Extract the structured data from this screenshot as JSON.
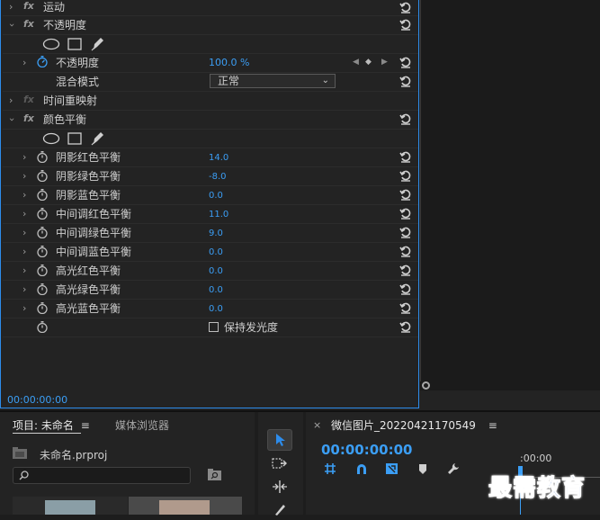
{
  "effects": {
    "motion": {
      "label": "运动"
    },
    "opacity": {
      "label": "不透明度",
      "property_label": "不透明度",
      "property_value": "100.0 %",
      "blend_label": "混合模式",
      "blend_value": "正常"
    },
    "time_remap": {
      "label": "时间重映射"
    },
    "color_balance": {
      "label": "颜色平衡",
      "params": [
        {
          "label": "阴影红色平衡",
          "value": "14.0"
        },
        {
          "label": "阴影绿色平衡",
          "value": "-8.0"
        },
        {
          "label": "阴影蓝色平衡",
          "value": "0.0"
        },
        {
          "label": "中间调红色平衡",
          "value": "11.0"
        },
        {
          "label": "中间调绿色平衡",
          "value": "9.0"
        },
        {
          "label": "中间调蓝色平衡",
          "value": "0.0"
        },
        {
          "label": "高光红色平衡",
          "value": "0.0"
        },
        {
          "label": "高光绿色平衡",
          "value": "0.0"
        },
        {
          "label": "高光蓝色平衡",
          "value": "0.0"
        }
      ],
      "preserve_label": "保持发光度"
    },
    "fx_icon": "fx",
    "timecode": "00:00:00:00"
  },
  "project": {
    "tab_label": "项目: 未命名",
    "media_browser_label": "媒体浏览器",
    "file_name": "未命名.prproj",
    "menu_icon": "≡"
  },
  "timeline": {
    "close": "×",
    "sequence_name": "微信图片_20220421170549",
    "menu_icon": "≡",
    "timecode": "00:00:00:00",
    "ruler_label": ":00:00"
  },
  "watermark": "最需教育",
  "colors": {
    "accent": "#2d8ceb",
    "value_blue": "#3b9ef5",
    "panel_bg": "#232323",
    "watermark": "#1a56c8"
  }
}
